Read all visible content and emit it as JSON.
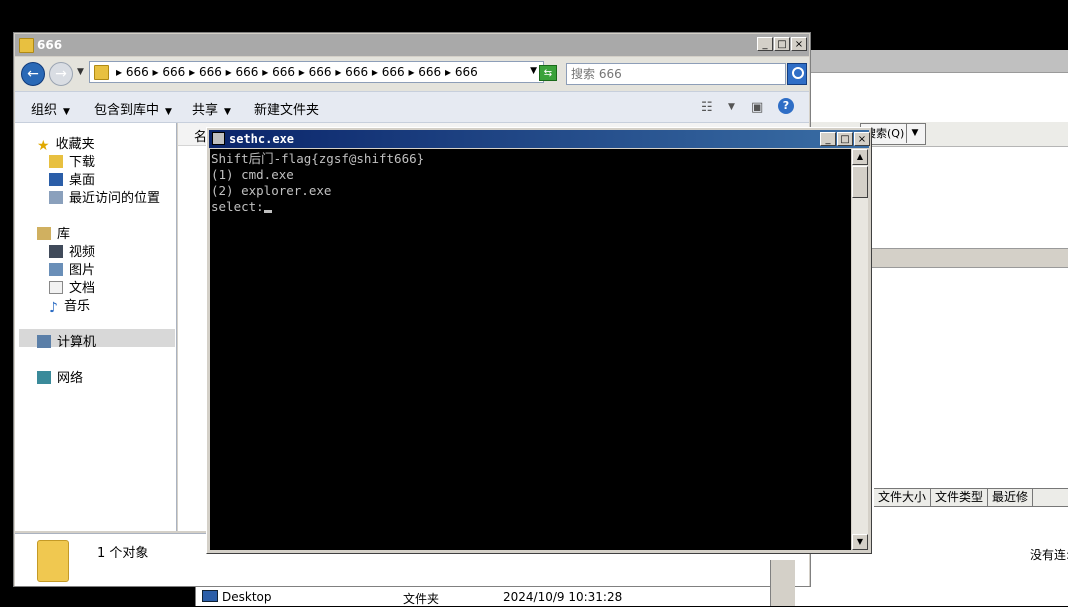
{
  "background_window": {
    "menu_item": "搜索(Q)",
    "column_headers": [
      "文件大小",
      "文件类型",
      "最近修"
    ],
    "status_text": "没有连:"
  },
  "explorer": {
    "title": "666",
    "address_crumbs": "▸ 666 ▸ 666 ▸ 666 ▸ 666 ▸ 666 ▸ 666 ▸ 666 ▸ 666 ▸ 666 ▸ 666",
    "search_placeholder": "搜索 666",
    "toolbar": {
      "organize": "组织",
      "include_library": "包含到库中",
      "share": "共享",
      "new_folder": "新建文件夹"
    },
    "nav": {
      "favorites": "收藏夹",
      "downloads": "下载",
      "desktop": "桌面",
      "recent": "最近访问的位置",
      "library": "库",
      "videos": "视频",
      "pictures": "图片",
      "documents": "文档",
      "music": "音乐",
      "computer": "计算机",
      "network": "网络"
    },
    "list_header_name": "名",
    "details_count": "1 个对象"
  },
  "bottom_row": {
    "name": "Desktop",
    "type": "文件夹",
    "date": "2024/10/9 10:31:28"
  },
  "console": {
    "title": "sethc.exe",
    "lines": [
      "Shift后门-flag{zgsf@shift666}",
      "(1) cmd.exe",
      "(2) explorer.exe"
    ],
    "prompt": "select:"
  },
  "colors": {
    "console_title": "#0a246a",
    "console_bg": "#000000",
    "console_text": "#c0c0c0",
    "back_button": "#2a69b6"
  }
}
